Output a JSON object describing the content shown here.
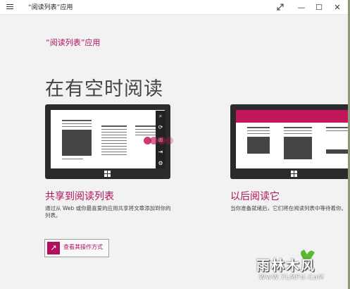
{
  "window": {
    "title": "“阅读列表”应用"
  },
  "titlebar": {
    "menu_icon": "hamburger-icon",
    "fullscreen_icon": "expand-icon",
    "minimize": "—",
    "maximize": "☐",
    "close": "✕"
  },
  "page": {
    "app_heading": "“阅读列表”应用",
    "hero": "在有空时阅读"
  },
  "sections": [
    {
      "title": "共享到阅读列表",
      "desc_line1": "通过从 Web 或你最喜爱的应用共享将文章添加到你的",
      "desc_line2": "列表。"
    },
    {
      "title": "以后阅读它",
      "desc_line1": "当你准备就绪后，它们将在阅读列表中等待着你。"
    }
  ],
  "action": {
    "label": "查看其操作方式",
    "icon": "arrow-up-right-icon"
  },
  "charm_bar": {
    "icons": [
      "search-icon",
      "share-icon",
      "start-icon",
      "devices-icon",
      "settings-icon"
    ]
  },
  "watermark": {
    "text": "雨林木风",
    "url": "WwW.YLMFU.CoM"
  },
  "colors": {
    "accent": "#b0105e",
    "background": "#f2f2f2",
    "device": "#2b2b2b"
  }
}
